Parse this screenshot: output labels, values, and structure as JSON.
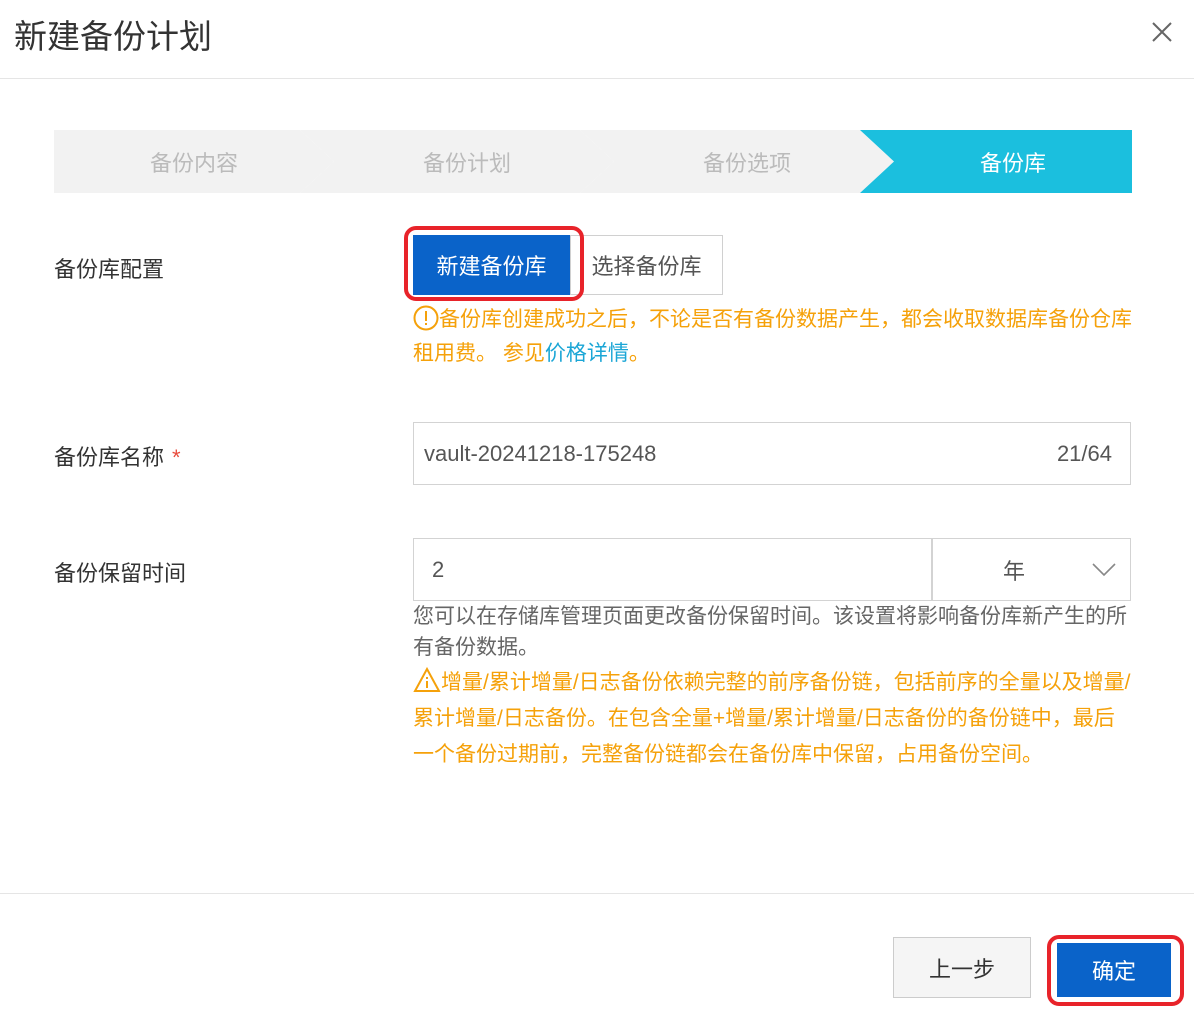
{
  "dialog": {
    "title": "新建备份计划"
  },
  "steps": [
    {
      "label": "备份内容"
    },
    {
      "label": "备份计划"
    },
    {
      "label": "备份选项"
    },
    {
      "label": "备份库"
    }
  ],
  "vault_config": {
    "label": "备份库配置",
    "new_label": "新建备份库",
    "select_label": "选择备份库",
    "notice_text": "备份库创建成功之后，不论是否有备份数据产生，都会收取数据库备份仓库租用费。 参见",
    "notice_link": "价格详情",
    "notice_end": "。"
  },
  "vault_name": {
    "label": "备份库名称",
    "required": "*",
    "value": "vault-20241218-175248",
    "count": "21/64"
  },
  "retention": {
    "label": "备份保留时间",
    "value": "2",
    "unit": "年",
    "help": "您可以在存储库管理页面更改备份保留时间。该设置将影响备份库新产生的所有备份数据。",
    "warning": "增量/累计增量/日志备份依赖完整的前序备份链，包括前序的全量以及增量/累计增量/日志备份。在包含全量+增量/累计增量/日志备份的备份链中，最后一个备份过期前，完整备份链都会在备份库中保留，占用备份空间。"
  },
  "footer": {
    "prev_label": "上一步",
    "ok_label": "确定"
  },
  "colors": {
    "primary": "#0a63c9",
    "active_step": "#1bbfde",
    "warning": "#f5a10a",
    "highlight": "#e8232a"
  }
}
